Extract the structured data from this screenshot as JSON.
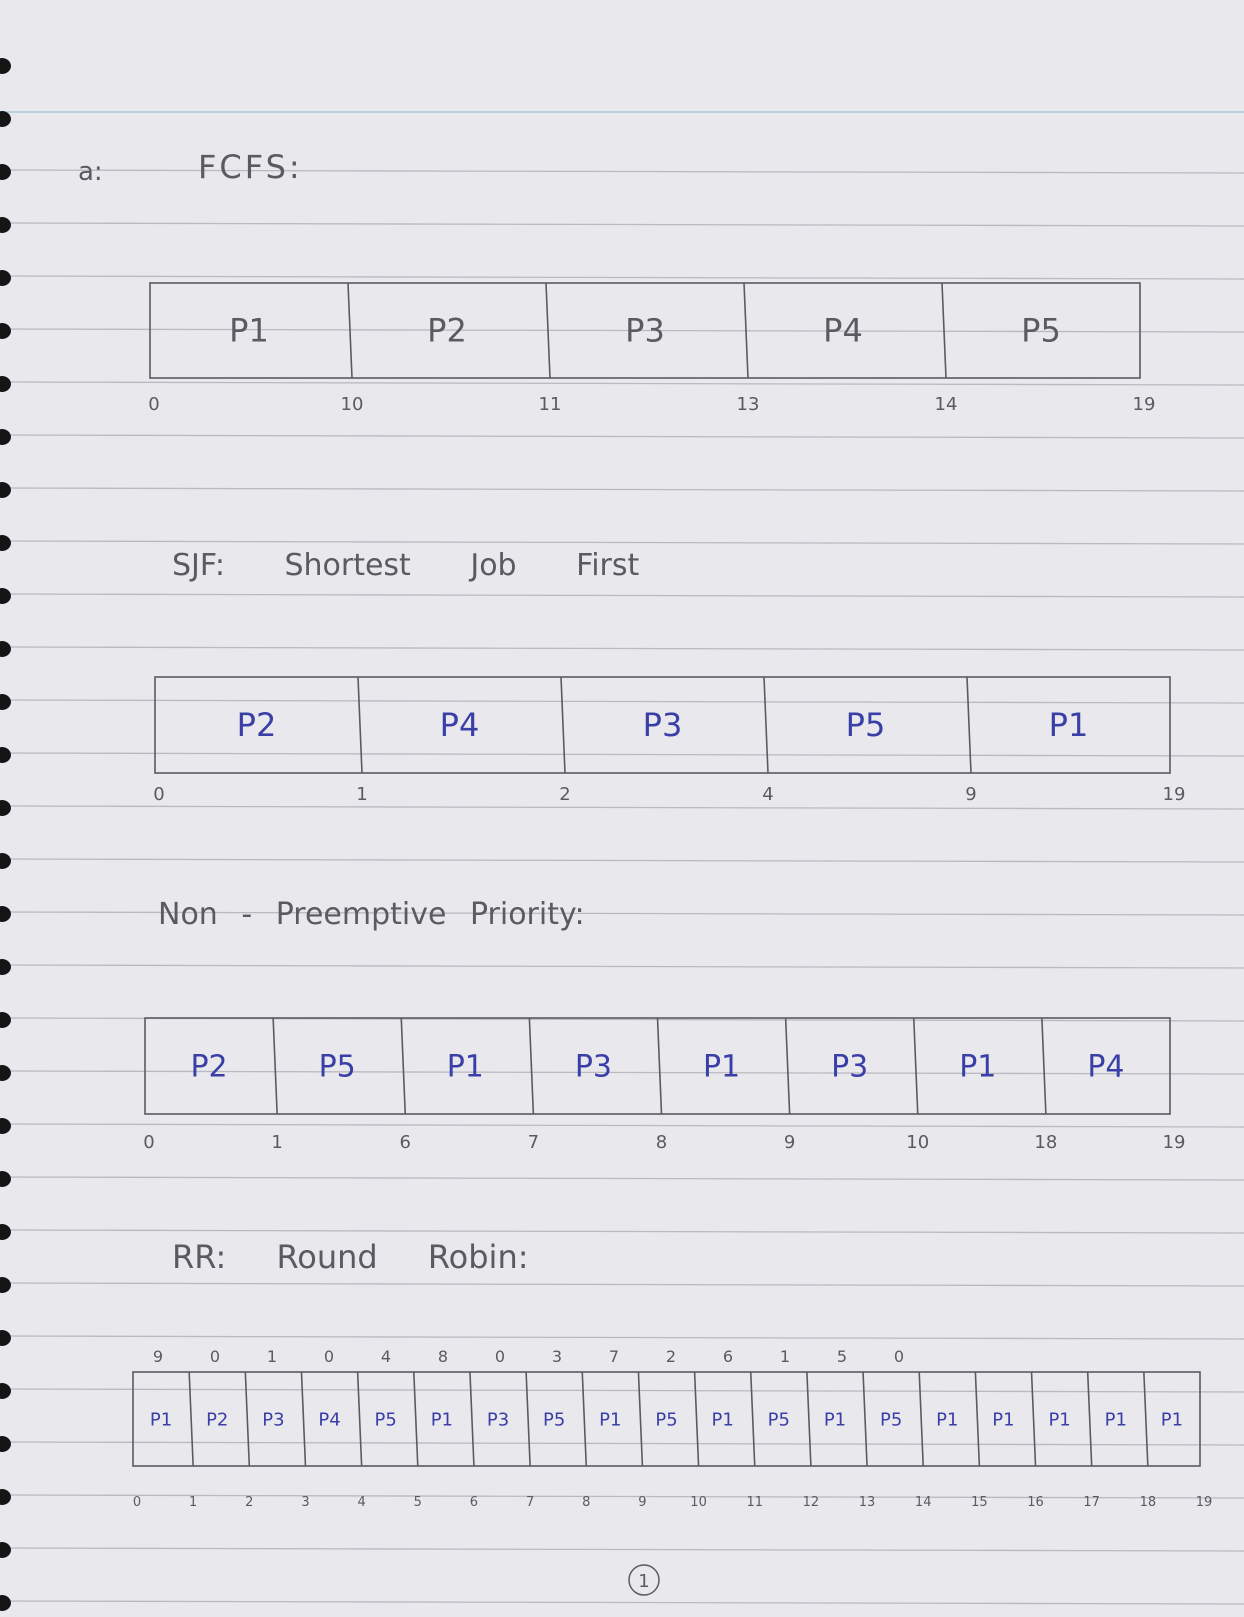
{
  "question_label": "a:",
  "page_number": "1",
  "sections": [
    {
      "title": "FCFS:",
      "blocks": [
        {
          "label": "P1",
          "start": 0,
          "end": 10
        },
        {
          "label": "P2",
          "start": 10,
          "end": 11
        },
        {
          "label": "P3",
          "start": 11,
          "end": 13
        },
        {
          "label": "P4",
          "start": 13,
          "end": 14
        },
        {
          "label": "P5",
          "start": 14,
          "end": 19
        }
      ],
      "ticks": [
        "0",
        "10",
        "11",
        "13",
        "14",
        "19"
      ]
    },
    {
      "title": "SJF: Shortest Job First",
      "blocks": [
        {
          "label": "P2",
          "start": 0,
          "end": 1
        },
        {
          "label": "P4",
          "start": 1,
          "end": 2
        },
        {
          "label": "P3",
          "start": 2,
          "end": 4
        },
        {
          "label": "P5",
          "start": 4,
          "end": 9
        },
        {
          "label": "P1",
          "start": 9,
          "end": 19
        }
      ],
      "ticks": [
        "0",
        "1",
        "2",
        "4",
        "9",
        "19"
      ]
    },
    {
      "title": "Non - Preemptive Priority:",
      "blocks": [
        {
          "label": "P2",
          "start": 0,
          "end": 1
        },
        {
          "label": "P5",
          "start": 1,
          "end": 6
        },
        {
          "label": "P1",
          "start": 6,
          "end": 7
        },
        {
          "label": "P3",
          "start": 7,
          "end": 8
        },
        {
          "label": "P1",
          "start": 8,
          "end": 9
        },
        {
          "label": "P3",
          "start": 9,
          "end": 10
        },
        {
          "label": "P1",
          "start": 10,
          "end": 18
        },
        {
          "label": "P4",
          "start": 18,
          "end": 19
        }
      ],
      "ticks": [
        "0",
        "1",
        "6",
        "7",
        "8",
        "9",
        "10",
        "18",
        "19"
      ]
    },
    {
      "title": "RR: Round Robin:",
      "remaining": [
        "9",
        "0",
        "1",
        "0",
        "4",
        "8",
        "0",
        "3",
        "7",
        "2",
        "6",
        "1",
        "5",
        "0"
      ],
      "blocks": [
        {
          "label": "P1",
          "start": 0,
          "end": 1
        },
        {
          "label": "P2",
          "start": 1,
          "end": 2
        },
        {
          "label": "P3",
          "start": 2,
          "end": 3
        },
        {
          "label": "P4",
          "start": 3,
          "end": 4
        },
        {
          "label": "P5",
          "start": 4,
          "end": 5
        },
        {
          "label": "P1",
          "start": 5,
          "end": 6
        },
        {
          "label": "P3",
          "start": 6,
          "end": 7
        },
        {
          "label": "P5",
          "start": 7,
          "end": 8
        },
        {
          "label": "P1",
          "start": 8,
          "end": 9
        },
        {
          "label": "P5",
          "start": 9,
          "end": 10
        },
        {
          "label": "P1",
          "start": 10,
          "end": 11
        },
        {
          "label": "P5",
          "start": 11,
          "end": 12
        },
        {
          "label": "P1",
          "start": 12,
          "end": 13
        },
        {
          "label": "P5",
          "start": 13,
          "end": 14
        },
        {
          "label": "P1",
          "start": 14,
          "end": 15
        },
        {
          "label": "P1",
          "start": 15,
          "end": 16
        },
        {
          "label": "P1",
          "start": 16,
          "end": 17
        },
        {
          "label": "P1",
          "start": 17,
          "end": 18
        },
        {
          "label": "P1",
          "start": 18,
          "end": 19
        }
      ],
      "ticks": [
        "0",
        "1",
        "2",
        "3",
        "4",
        "5",
        "6",
        "7",
        "8",
        "9",
        "10",
        "11",
        "12",
        "13",
        "14",
        "15",
        "16",
        "17",
        "18",
        "19"
      ]
    }
  ],
  "colors": {
    "paper": "#e9e8ec",
    "rule_line": "#b9b9c0",
    "top_rule": "#a9c9d6",
    "pencil": "#5a5a60",
    "blue_ink": "#3a3fa8",
    "binding_hole": "#151515"
  }
}
